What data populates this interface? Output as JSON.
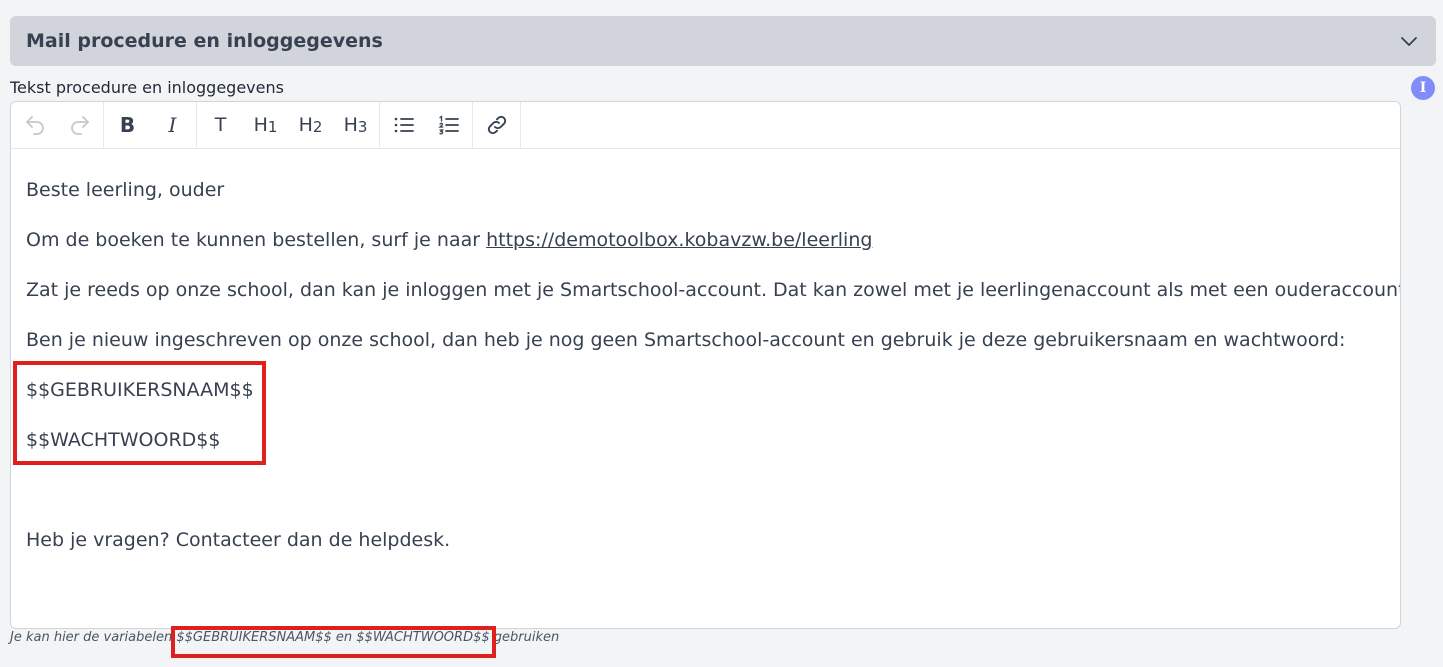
{
  "section": {
    "title": "Mail procedure en inloggegevens",
    "chevron_icon": "chevron-down-icon"
  },
  "field": {
    "label": "Tekst procedure en inloggegevens",
    "info_icon_glyph": "I"
  },
  "toolbar": {
    "undo": "undo-icon",
    "redo": "redo-icon",
    "bold": "B",
    "italic": "I",
    "text": "T",
    "h1": "H",
    "h1_num": "1",
    "h2": "H",
    "h2_num": "2",
    "h3": "H",
    "h3_num": "3",
    "bullet_list": "bullet-list-icon",
    "ordered_list": "ordered-list-icon",
    "link": "link-icon"
  },
  "content": {
    "greeting": "Beste leerling, ouder",
    "order_prefix": "Om de boeken te kunnen bestellen, surf je naar ",
    "order_link": "https://demotoolbox.kobavzw.be/leerling",
    "existing_students": "Zat je reeds op onze school, dan kan je inloggen met je Smartschool-account. Dat kan zowel met je leerlingenaccount als met een ouderaccount.",
    "new_students": "Ben je nieuw ingeschreven op onze school, dan heb je nog geen Smartschool-account en gebruik je deze gebruikersnaam en wachtwoord:",
    "username_var": "$$GEBRUIKERSNAAM$$",
    "password_var": "$$WACHTWOORD$$",
    "questions": "Heb je vragen? Contacteer dan de helpdesk."
  },
  "helper": {
    "prefix": "Je kan hier de variabelen ",
    "variables": "$$GEBRUIKERSNAAM$$ en $$WACHTWOORD$$",
    "suffix": " gebruiken"
  },
  "colors": {
    "highlight_box": "#e0201c",
    "info_icon": "#818cf8",
    "header_bg": "#d1d5db"
  }
}
